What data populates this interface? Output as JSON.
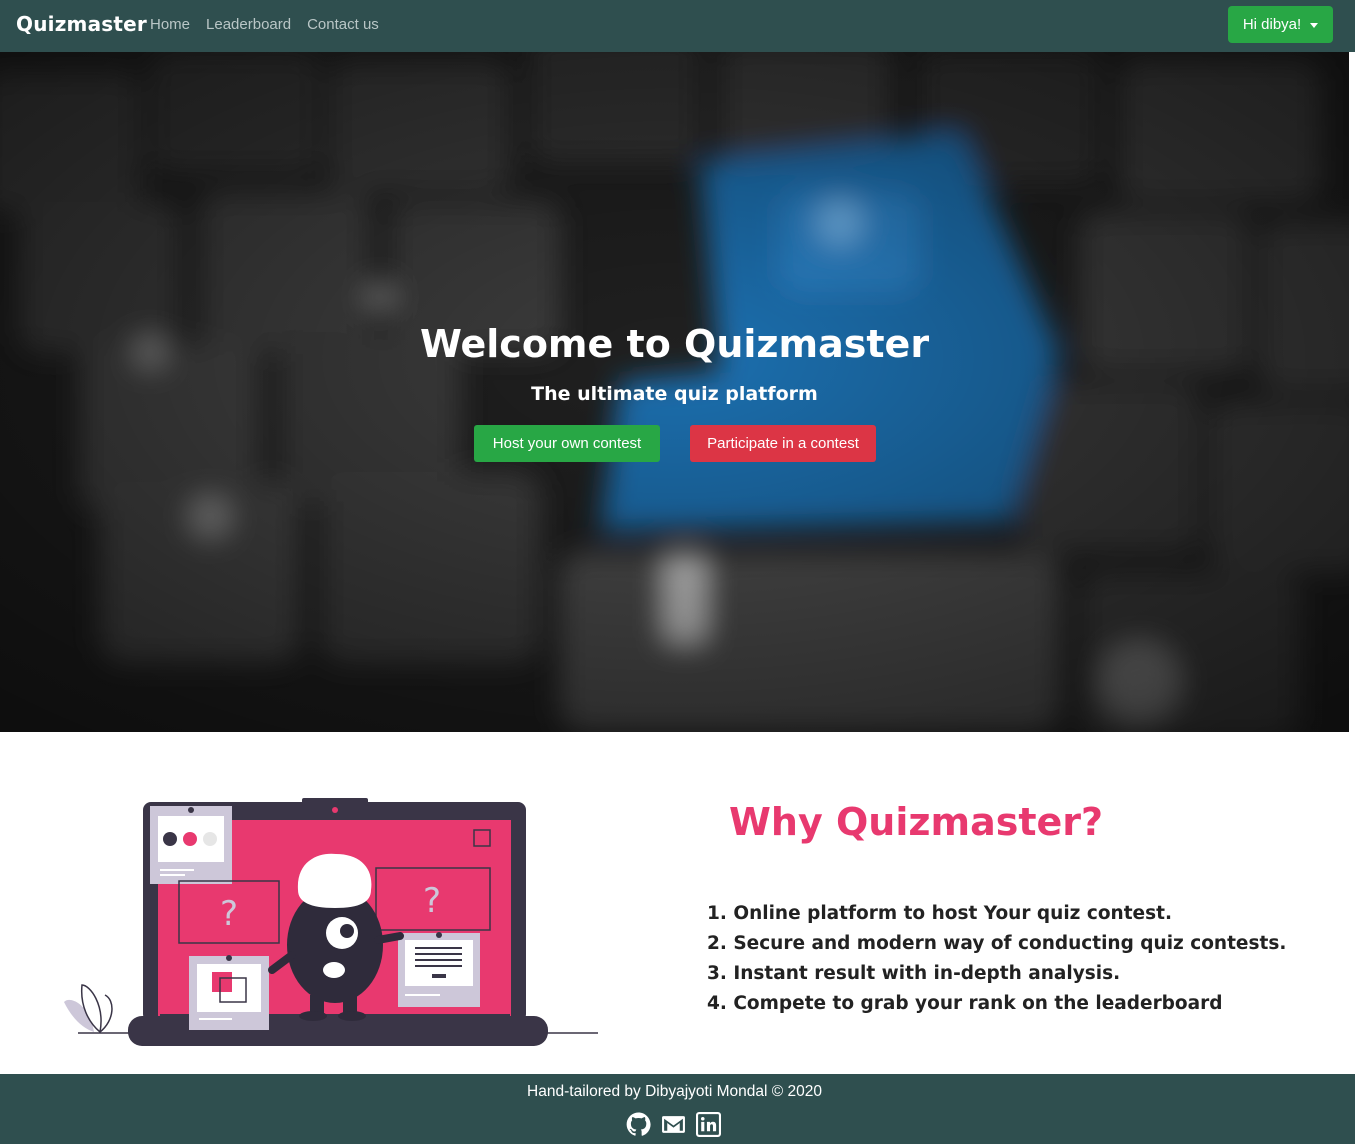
{
  "navbar": {
    "brand": "Quizmaster",
    "links": [
      "Home",
      "Leaderboard",
      "Contact us"
    ],
    "user_button": "Hi dibya!"
  },
  "hero": {
    "title": "Welcome to Quizmaster",
    "subtitle": "The ultimate quiz platform",
    "host_button": "Host your own contest",
    "participate_button": "Participate in a contest"
  },
  "why": {
    "title": "Why Quizmaster?",
    "points": [
      "1. Online platform to host Your quiz contest.",
      "2. Secure and modern way of conducting quiz contests.",
      "3. Instant result with in-depth analysis.",
      "4. Compete to grab your rank on the leaderboard"
    ]
  },
  "footer": {
    "credit": "Hand-tailored by Dibyajyoti Mondal © 2020",
    "icons": [
      "github-icon",
      "gmail-icon",
      "linkedin-icon"
    ]
  },
  "colors": {
    "navbar": "#2f4f4f",
    "success": "#28a745",
    "danger": "#dc3545",
    "accent_pink": "#e8396f"
  }
}
